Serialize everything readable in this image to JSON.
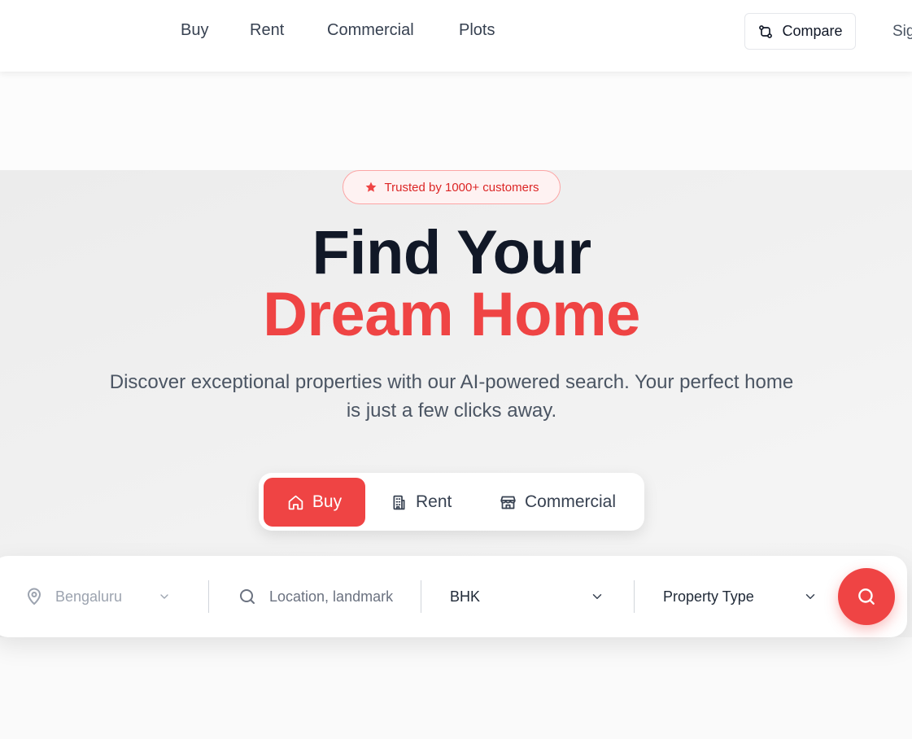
{
  "nav": {
    "links": [
      "Buy",
      "Rent",
      "Commercial",
      "Plots"
    ],
    "compare_label": "Compare",
    "signin_label": "Sig"
  },
  "hero": {
    "badge_text": "Trusted by 1000+ customers",
    "headline_line1": "Find Your",
    "headline_line2": "Dream Home",
    "subtitle": "Discover exceptional properties with our AI-powered search. Your perfect home is just a few clicks away."
  },
  "mode_tabs": [
    {
      "label": "Buy",
      "icon": "home-icon",
      "active": true
    },
    {
      "label": "Rent",
      "icon": "building-icon",
      "active": false
    },
    {
      "label": "Commercial",
      "icon": "store-icon",
      "active": false
    }
  ],
  "search": {
    "city_value": "Bengaluru",
    "location_placeholder": "Location, landmark",
    "bhk_value": "BHK",
    "property_type_value": "Property Type"
  },
  "colors": {
    "accent": "#ef4444",
    "heading": "#111827",
    "body_text": "#4b5563",
    "badge_bg": "#fef2f2"
  }
}
